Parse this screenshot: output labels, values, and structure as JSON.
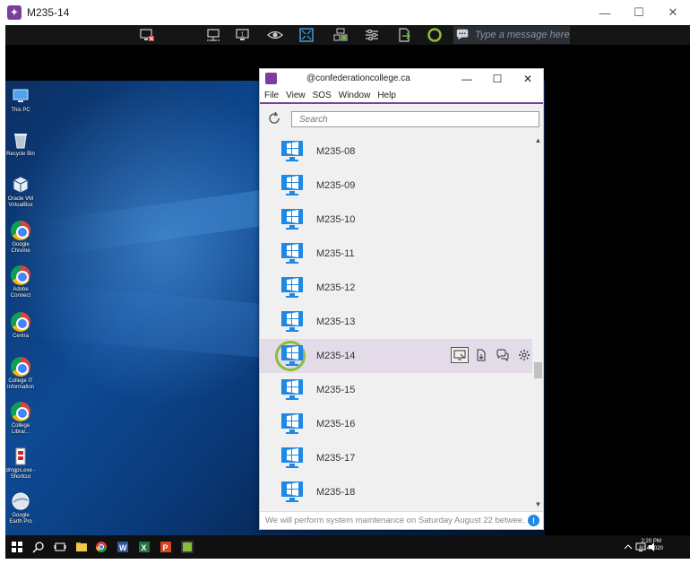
{
  "window": {
    "title": "M235-14",
    "controls": {
      "minimize": "—",
      "maximize": "☐",
      "close": "✕"
    }
  },
  "toolbar": {
    "icons": [
      "disconnect-screen-icon",
      "monitor-select-icon",
      "screen-one-icon",
      "view-only-icon",
      "fullscreen-icon",
      "remote-control-icon",
      "settings-sliders-icon",
      "transfer-icon",
      "status-ring-icon",
      "chat-icon"
    ],
    "message_placeholder": "Type a message here"
  },
  "desktop": {
    "icons": [
      {
        "label": "This PC",
        "name": "this-pc-icon"
      },
      {
        "label": "Recycle Bin",
        "name": "recycle-bin-icon"
      },
      {
        "label": "Oracle VM VirtualBox",
        "name": "virtualbox-icon"
      },
      {
        "label": "Google Chrome",
        "name": "chrome-icon"
      },
      {
        "label": "Adobe Connect",
        "name": "adobe-connect-icon"
      },
      {
        "label": "Centra",
        "name": "centra-icon"
      },
      {
        "label": "College IT Information",
        "name": "college-it-icon"
      },
      {
        "label": "College Librar...",
        "name": "college-library-icon"
      },
      {
        "label": "dmgps.exe - Shortcut",
        "name": "dmgps-icon"
      },
      {
        "label": "Google Earth Pro",
        "name": "google-earth-icon"
      }
    ],
    "clock": {
      "time": "2:20 PM",
      "date": "8/14/2020"
    }
  },
  "app": {
    "title": "@confederationcollege.ca",
    "menu": [
      "File",
      "View",
      "SOS",
      "Window",
      "Help"
    ],
    "search_placeholder": "Search",
    "computers": [
      "M235-08",
      "M235-09",
      "M235-10",
      "M235-11",
      "M235-12",
      "M235-13",
      "M235-14",
      "M235-15",
      "M235-16",
      "M235-17",
      "M235-18"
    ],
    "selected": "M235-14",
    "status_message": "We will perform system maintenance on Saturday August 22 betwee..."
  },
  "colors": {
    "brand": "#7a3f98",
    "selected_row": "#e3dbe8",
    "online_ring": "#8bbd3c",
    "info": "#1e88e5"
  }
}
